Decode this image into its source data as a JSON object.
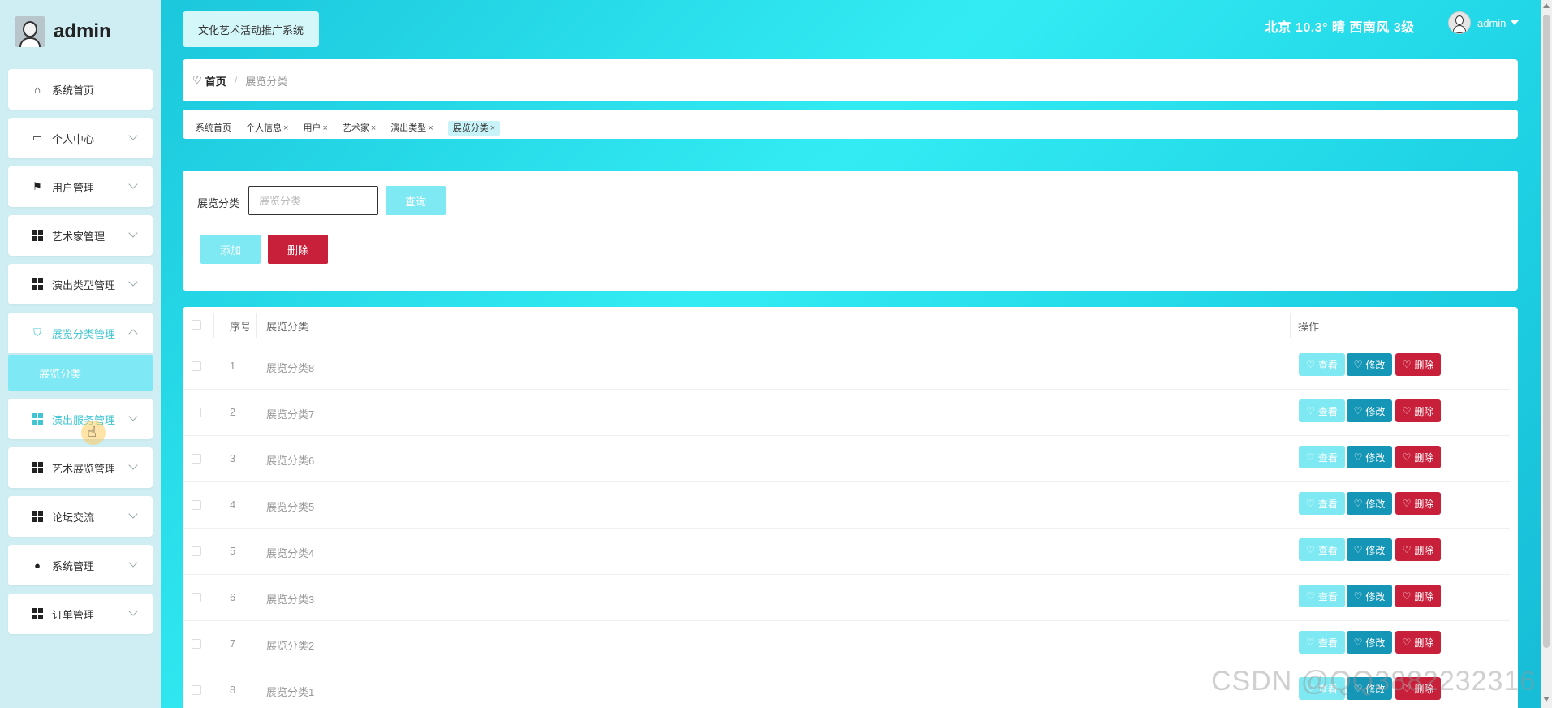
{
  "brand": {
    "name": "admin"
  },
  "sidebar": {
    "items": [
      {
        "label": "系统首页",
        "icon": "home-icon"
      },
      {
        "label": "个人中心",
        "icon": "wallet-icon"
      },
      {
        "label": "用户管理",
        "icon": "flag-icon"
      },
      {
        "label": "艺术家管理",
        "icon": "grid-icon"
      },
      {
        "label": "演出类型管理",
        "icon": "grid-icon"
      },
      {
        "label": "展览分类管理",
        "icon": "ticket-icon"
      },
      {
        "label": "演出服务管理",
        "icon": "grid-icon"
      },
      {
        "label": "艺术展览管理",
        "icon": "grid-icon"
      },
      {
        "label": "论坛交流",
        "icon": "grid-icon"
      },
      {
        "label": "系统管理",
        "icon": "pin-icon"
      },
      {
        "label": "订单管理",
        "icon": "grid-icon"
      }
    ],
    "submenu": {
      "label": "展览分类"
    }
  },
  "header": {
    "system_title": "文化艺术活动推广系统",
    "weather": "北京 10.3° 晴 西南风 3级",
    "user": "admin"
  },
  "breadcrumb": {
    "home": "首页",
    "separator": "/",
    "current": "展览分类"
  },
  "tags": [
    {
      "label": "系统首页",
      "closable": false
    },
    {
      "label": "个人信息",
      "closable": true
    },
    {
      "label": "用户",
      "closable": true
    },
    {
      "label": "艺术家",
      "closable": true
    },
    {
      "label": "演出类型",
      "closable": true
    },
    {
      "label": "展览分类",
      "closable": true
    }
  ],
  "search": {
    "label": "展览分类",
    "placeholder": "展览分类",
    "query_label": "查询",
    "add_label": "添加",
    "delete_label": "删除"
  },
  "table": {
    "columns": {
      "no": "序号",
      "name": "展览分类",
      "ops": "操作"
    },
    "rows": [
      {
        "no": "1",
        "name": "展览分类8"
      },
      {
        "no": "2",
        "name": "展览分类7"
      },
      {
        "no": "3",
        "name": "展览分类6"
      },
      {
        "no": "4",
        "name": "展览分类5"
      },
      {
        "no": "5",
        "name": "展览分类4"
      },
      {
        "no": "6",
        "name": "展览分类3"
      },
      {
        "no": "7",
        "name": "展览分类2"
      },
      {
        "no": "8",
        "name": "展览分类1"
      }
    ],
    "ops": {
      "view": "查看",
      "edit": "修改",
      "delete": "删除"
    }
  },
  "watermark": "CSDN @QQ3882232316",
  "colors": {
    "accent": "#33ecf3",
    "light_btn": "#7fe9f3",
    "edit_btn": "#1696b6",
    "danger": "#c81f3a"
  }
}
